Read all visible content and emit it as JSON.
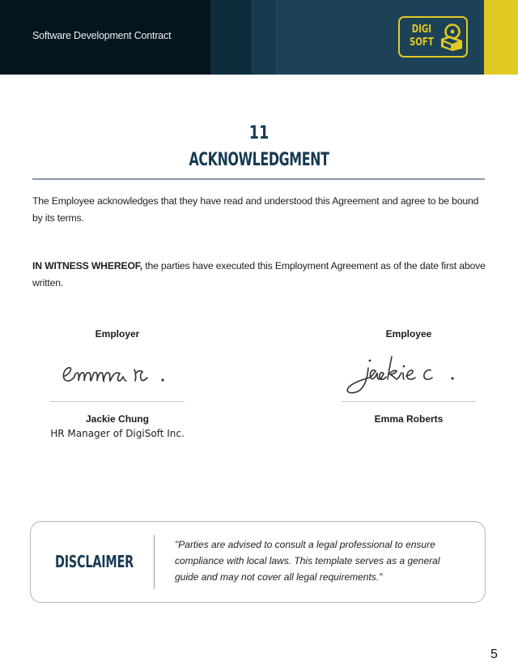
{
  "header": {
    "document_title": "Software Development Contract",
    "logo": {
      "line1": "DIGI",
      "line2": "SOFT",
      "icon": "cd-box-icon"
    },
    "colors": {
      "dark": "#05151d",
      "navy": "#1d4257",
      "accent_yellow": "#e1c923"
    }
  },
  "section": {
    "number": "11",
    "title": "ACKNOWLEDGMENT",
    "title_color": "#173a52"
  },
  "body": {
    "paragraph1": "The Employee acknowledges that they have read and understood this Agreement and agree to be bound by its terms.",
    "paragraph2_bold": "IN WITNESS WHEREOF,",
    "paragraph2_rest": " the parties have executed this Employment Agreement as of the date first above written."
  },
  "signatures": [
    {
      "role": "Employer",
      "signature": "emma r.",
      "name": "Jackie Chung",
      "title": "HR Manager of DigiSoft Inc."
    },
    {
      "role": "Employee",
      "signature": "jackie c.",
      "name": "Emma Roberts",
      "title": ""
    }
  ],
  "disclaimer": {
    "label": "DISCLAIMER",
    "text": "\"Parties are advised to consult a legal professional to ensure compliance with local laws. This template serves as a general guide and may not cover all legal requirements.\""
  },
  "footer": {
    "page_number": "5"
  }
}
